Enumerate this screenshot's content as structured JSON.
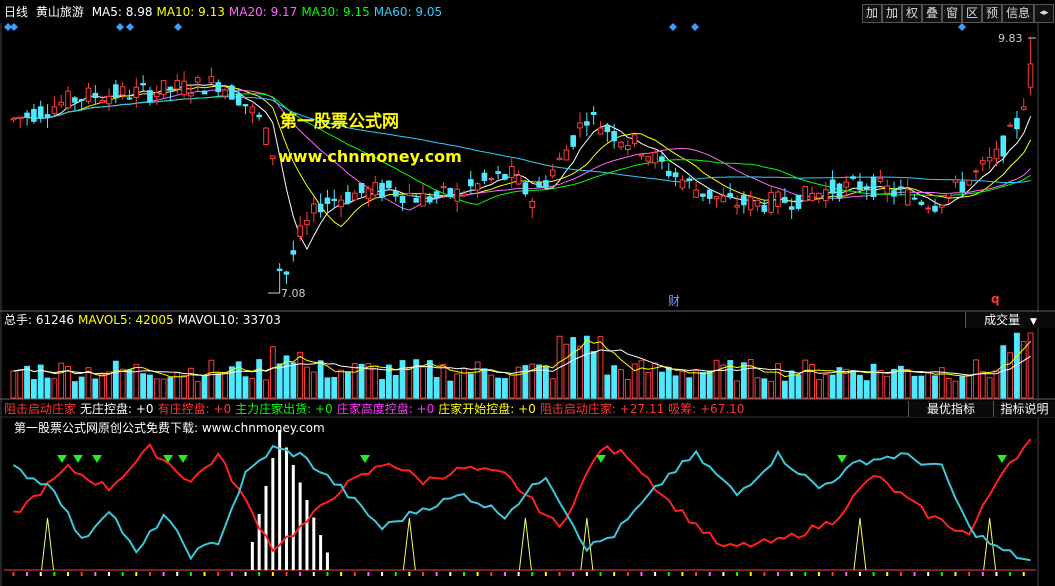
{
  "header": {
    "period": "日线",
    "stock_name": "黄山旅游",
    "ma": [
      {
        "label": "MA5:",
        "value": "8.98",
        "color": "#ffffff"
      },
      {
        "label": "MA10:",
        "value": "9.13",
        "color": "#ffff00"
      },
      {
        "label": "MA20:",
        "value": "9.17",
        "color": "#ff66ff"
      },
      {
        "label": "MA30:",
        "value": "9.15",
        "color": "#00ff00"
      },
      {
        "label": "MA60:",
        "value": "9.05",
        "color": "#33ccff"
      }
    ]
  },
  "toolbar": [
    {
      "label": "加",
      "icon": ""
    },
    {
      "label": "加",
      "icon": ""
    },
    {
      "label": "权",
      "icon": ""
    },
    {
      "label": "叠",
      "icon": ""
    },
    {
      "label": "窗",
      "icon": ""
    },
    {
      "label": "区",
      "icon": ""
    },
    {
      "label": "预",
      "icon": ""
    },
    {
      "label": "信息",
      "icon": ""
    },
    {
      "label": "",
      "icon": "scroll-arrows-icon"
    }
  ],
  "watermark": {
    "line1": "第一股票公式网",
    "line2": "www.chnmoney.com"
  },
  "price_panel": {
    "high_label": "9.83",
    "low_label": "7.08",
    "fin_marker": "财",
    "q_marker": "q"
  },
  "volume_panel": {
    "items": [
      {
        "label": "总手:",
        "value": "61246",
        "color": "#ffffff"
      },
      {
        "label": "MAVOL5:",
        "value": "42005",
        "color": "#ffff00"
      },
      {
        "label": "MAVOL10:",
        "value": "33703",
        "color": "#ffffff"
      }
    ],
    "button": "成交量"
  },
  "indicator_panel": {
    "items": [
      {
        "label": "阻击启动庄家",
        "value": "",
        "color": "#ff3333"
      },
      {
        "label": "无庄控盘:",
        "value": "+0",
        "color": "#ffffff"
      },
      {
        "label": "有庄控盘:",
        "value": "+0",
        "color": "#ff3333"
      },
      {
        "label": "主力庄家出货:",
        "value": "+0",
        "color": "#00ff00"
      },
      {
        "label": "庄家高度控盘:",
        "value": "+0",
        "color": "#ff33ff"
      },
      {
        "label": "庄家开始控盘:",
        "value": "+0",
        "color": "#ffff00"
      },
      {
        "label": "阻击启动庄家:",
        "value": "+27.11",
        "color": "#ff3333"
      },
      {
        "label": "吸筹:",
        "value": "+67.10",
        "color": "#ff3333"
      }
    ],
    "subtitle": "第一股票公式网原创公式免费下载: www.chnmoney.com",
    "buttons": [
      "最优指标",
      "指标说明"
    ]
  },
  "chart_data": {
    "type": "candlestick",
    "price_axis": {
      "high": 9.83,
      "low": 7.08
    },
    "x_count": 150,
    "key_points": [
      {
        "label": "7.08",
        "meaning": "lowest price"
      },
      {
        "label": "9.83",
        "meaning": "latest high"
      }
    ],
    "volume": {
      "latest": 61246,
      "mavol5": 42005,
      "mavol10": 33703
    },
    "indicator": {
      "zujiqidong": 27.11,
      "xichou": 67.1
    }
  }
}
